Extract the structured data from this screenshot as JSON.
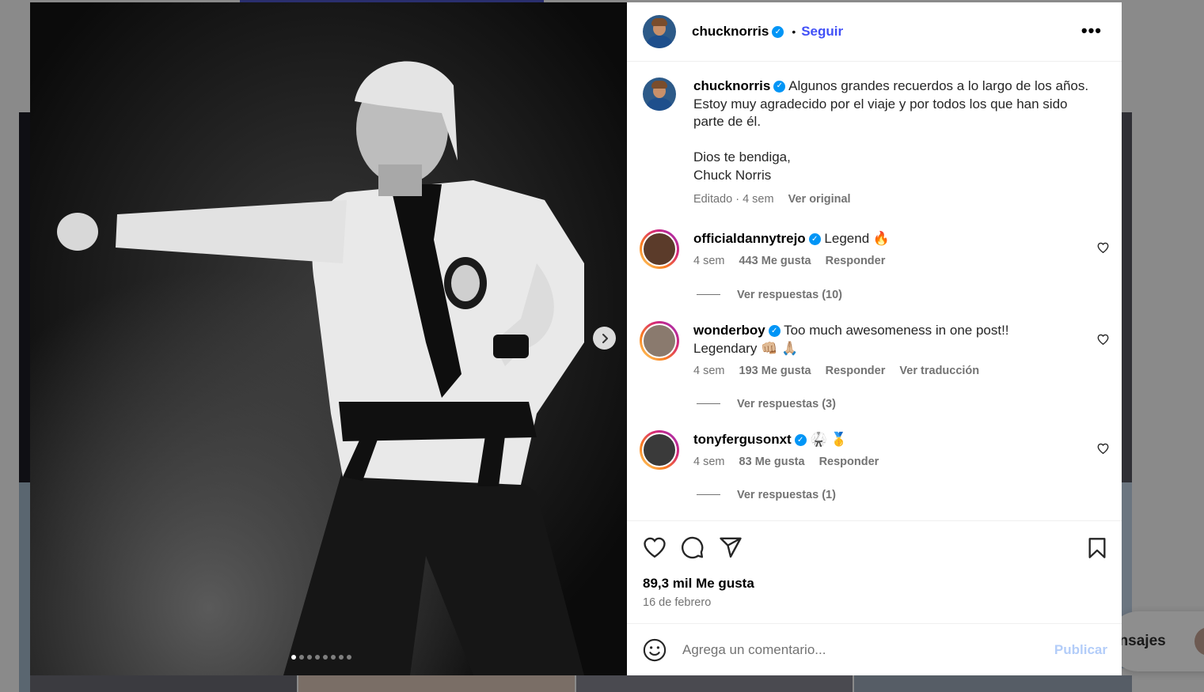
{
  "background": {
    "messages_label": "ensajes"
  },
  "post": {
    "author": "chucknorris",
    "follow_label": "Seguir",
    "separator": "•",
    "more_label": "•••",
    "media": {
      "image_count": 8,
      "active_index": 0
    },
    "caption": {
      "user": "chucknorris",
      "line1": "Algunos grandes recuerdos a lo largo de los años.",
      "line2": "Estoy muy agradecido por el viaje y por todos los que han sido parte de él.",
      "line3": "Dios te bendiga,",
      "line4": "Chuck Norris",
      "edited": "Editado · 4 sem",
      "see_original": "Ver original"
    },
    "comments": [
      {
        "user": "officialdannytrejo",
        "text": "Legend",
        "emoji": "🔥",
        "time": "4 sem",
        "likes": "443 Me gusta",
        "reply": "Responder",
        "translate": "",
        "view_replies": "Ver respuestas (10)",
        "avatar_color": "#5b3b2a"
      },
      {
        "user": "wonderboy",
        "text": "Too much awesomeness in one post!!",
        "text2": "Legendary 👊🏼 🙏🏼",
        "time": "4 sem",
        "likes": "193 Me gusta",
        "reply": "Responder",
        "translate": "Ver traducción",
        "view_replies": "Ver respuestas (3)",
        "avatar_color": "#8a7a6e"
      },
      {
        "user": "tonyfergusonxt",
        "text": "",
        "emoji": "🥋 🥇",
        "time": "4 sem",
        "likes": "83 Me gusta",
        "reply": "Responder",
        "translate": "",
        "view_replies": "Ver respuestas (1)",
        "avatar_color": "#3a3a3a"
      }
    ],
    "likes_count": "89,3 mil Me gusta",
    "date": "16 de febrero",
    "comment_placeholder": "Agrega un comentario...",
    "publish_label": "Publicar"
  },
  "colors": {
    "accent": "#4150f7",
    "verified": "#0095f6",
    "muted": "#737373"
  }
}
